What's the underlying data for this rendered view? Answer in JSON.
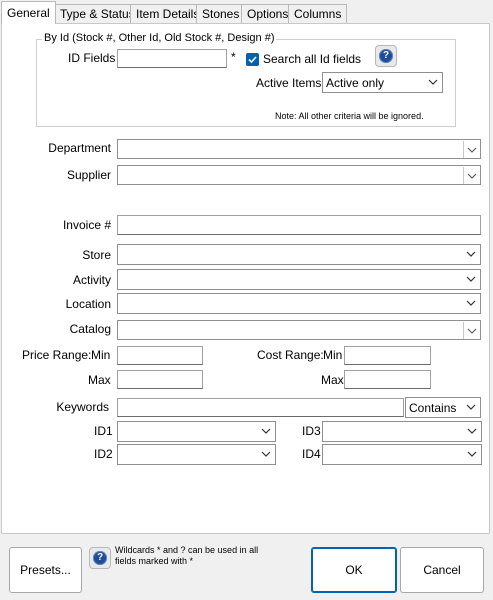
{
  "tabs": [
    {
      "label": "General",
      "active": true
    },
    {
      "label": "Type & Status"
    },
    {
      "label": "Item Details"
    },
    {
      "label": "Stones"
    },
    {
      "label": "Options"
    },
    {
      "label": "Columns"
    }
  ],
  "by_id": {
    "group_label": "By Id  (Stock #, Other Id, Old Stock #, Design #)",
    "id_fields_label": "ID Fields",
    "id_fields_value": "",
    "required_marker": "*",
    "search_all_label": "Search all Id fields",
    "search_all_checked": true,
    "active_items_label": "Active Items",
    "active_items_value": "Active only",
    "note": "Note: All other criteria will be ignored."
  },
  "fields": {
    "department_label": "Department",
    "supplier_label": "Supplier",
    "invoice_label": "Invoice #",
    "store_label": "Store",
    "activity_label": "Activity",
    "location_label": "Location",
    "catalog_label": "Catalog",
    "price_range_label": "Price Range:",
    "price_min_label": "Min",
    "price_max_label": "Max",
    "cost_range_label": "Cost Range:",
    "cost_min_label": "Min",
    "cost_max_label": "Max",
    "keywords_label": "Keywords",
    "keywords_mode": "Contains",
    "id1_label": "ID1",
    "id2_label": "ID2",
    "id3_label": "ID3",
    "id4_label": "ID4"
  },
  "footer": {
    "presets_label": "Presets...",
    "wildcard_note": "Wildcards * and ? can be used in all fields marked with *",
    "ok_label": "OK",
    "cancel_label": "Cancel"
  },
  "icons": {
    "help": "question-mark-icon",
    "dropdown": "chevron-down-icon",
    "check": "checkmark-icon"
  },
  "colors": {
    "accent": "#0063b1",
    "help_icon": "#1f4e96"
  }
}
